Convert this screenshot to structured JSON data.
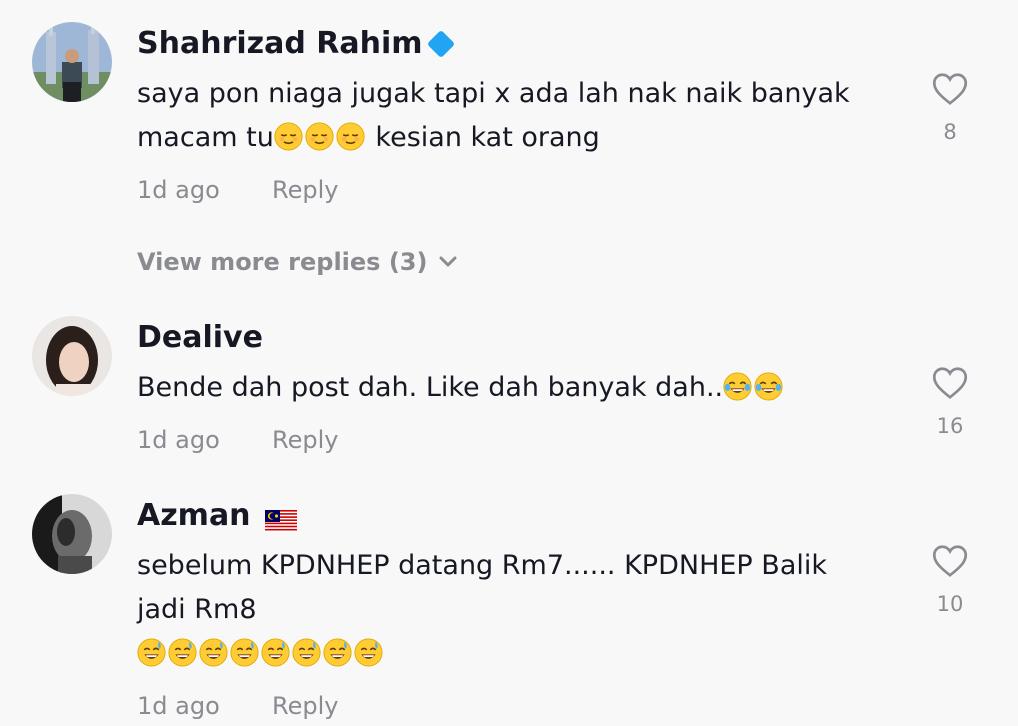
{
  "comments": [
    {
      "username": "Shahrizad Rahim",
      "badge": "verified-icon",
      "text": "saya pon niaga jugak tapi x ada lah nak naik banyak macam tu",
      "text_after_emoji": "kesian kat orang",
      "emoji": "relieved-face",
      "emoji_count": 3,
      "time": "1d ago",
      "reply_label": "Reply",
      "likes": "8"
    },
    {
      "username": "Dealive",
      "text": "Bende dah post dah. Like dah banyak dah..",
      "emoji": "tears-of-joy-face",
      "emoji_count": 2,
      "time": "1d ago",
      "reply_label": "Reply",
      "likes": "16"
    },
    {
      "username": "Azman",
      "badge": "malaysia-flag-icon",
      "text_line1": "sebelum KPDNHEP datang Rm7...... KPDNHEP Balik",
      "text_line2": "jadi Rm8",
      "emoji": "grinning-sweat-face",
      "emoji_count": 8,
      "time": "1d ago",
      "reply_label": "Reply",
      "likes": "10"
    }
  ],
  "view_more_replies": "View more replies (3)",
  "colors": {
    "background": "#f8f8f8",
    "primary_text": "#161823",
    "secondary_text": "#8a8b91",
    "verified_badge": "#20a4f3"
  }
}
